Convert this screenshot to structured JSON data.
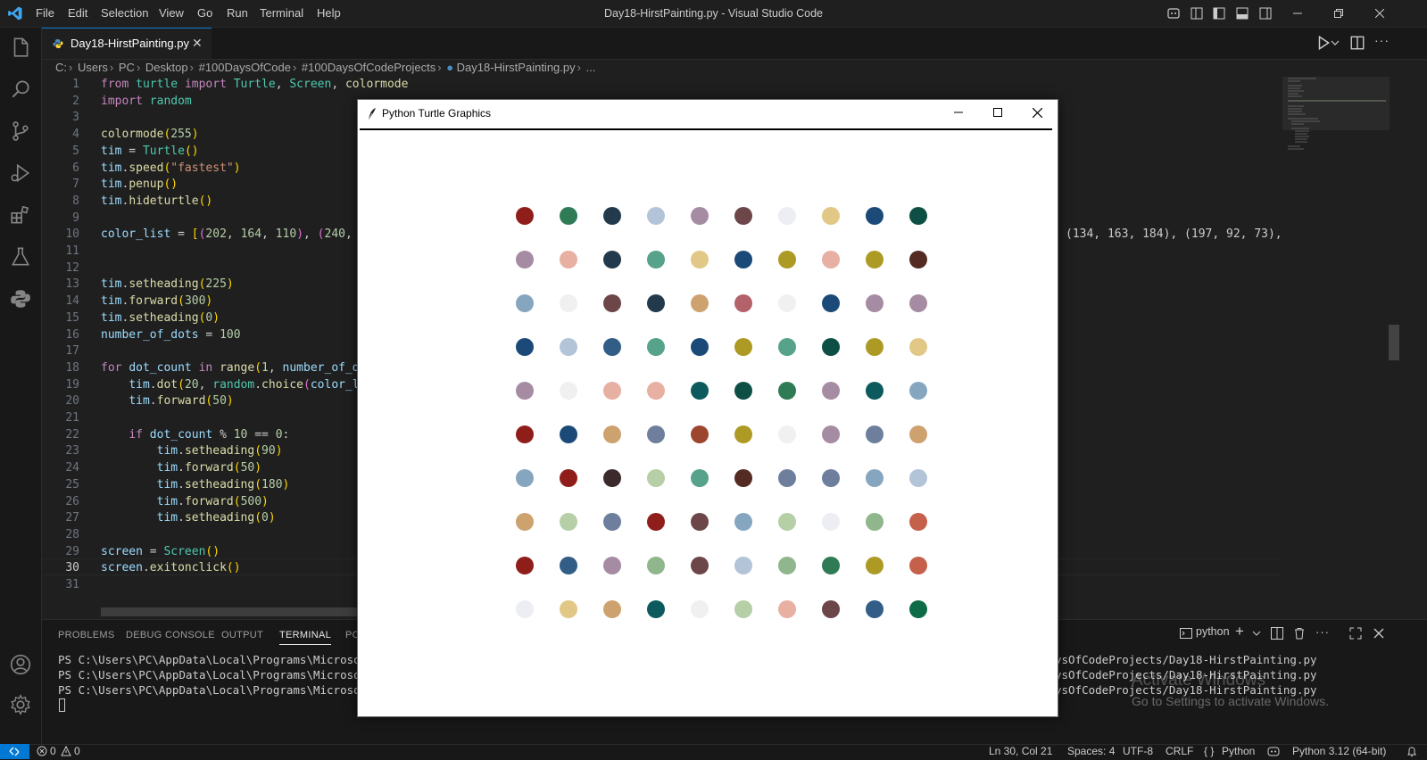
{
  "menu": [
    "File",
    "Edit",
    "Selection",
    "View",
    "Go",
    "Run",
    "Terminal",
    "Help"
  ],
  "window_title": "Day18-HirstPainting.py - Visual Studio Code",
  "tab": {
    "label": "Day18-HirstPainting.py",
    "close": "✕"
  },
  "breadcrumb": [
    "C:",
    "Users",
    "PC",
    "Desktop",
    "#100DaysOfCode",
    "#100DaysOfCodeProjects",
    "Day18-HirstPainting.py",
    "..."
  ],
  "line_numbers": [
    "1",
    "2",
    "3",
    "4",
    "5",
    "6",
    "7",
    "8",
    "9",
    "10",
    "11",
    "12",
    "13",
    "14",
    "15",
    "16",
    "17",
    "18",
    "19",
    "20",
    "21",
    "22",
    "23",
    "24",
    "25",
    "26",
    "27",
    "28",
    "29",
    "30",
    "31"
  ],
  "code_right_fragment": "(134, 163, 184), (197, 92, 73),",
  "panel_tabs": [
    "PROBLEMS",
    "DEBUG CONSOLE",
    "OUTPUT",
    "TERMINAL",
    "PC"
  ],
  "terminal": {
    "shell_label": "python",
    "line_left": "PS C:\\Users\\PC\\AppData\\Local\\Programs\\Microsoft \\",
    "line_right": "ysOfCodeProjects/Day18-HirstPainting.py"
  },
  "watermark": {
    "title": "Activate Windows",
    "subtitle": "Go to Settings to activate Windows."
  },
  "status": {
    "problems": "0",
    "warnings": "0",
    "position": "Ln 30, Col 21",
    "spaces": "Spaces: 4",
    "encoding": "UTF-8",
    "eol": "CRLF",
    "language": "Python",
    "interpreter": "Python 3.12 (64-bit)"
  },
  "turtle_window": {
    "title": "Python Turtle Graphics"
  },
  "dot_grid": [
    [
      "#8f1e1a",
      "#2f7b55",
      "#233a4c",
      "#b3c3d8",
      "#a68ca2",
      "#6c4649",
      "#eceef3",
      "#e2c886",
      "#1c4a78",
      "#0e4f45"
    ],
    [
      "#a68ca2",
      "#e8afa3",
      "#233a4c",
      "#56a28b",
      "#e2c886",
      "#1c4a78",
      "#ad9a25",
      "#e8afa3",
      "#ad9a25",
      "#532b22"
    ],
    [
      "#86a6c0",
      "#eff0ef",
      "#6c4649",
      "#233a4c",
      "#cda26f",
      "#b26268",
      "#eff0ef",
      "#1c4a78",
      "#a68ca2",
      "#a68ca2"
    ],
    [
      "#1c4a78",
      "#b3c3d8",
      "#325d86",
      "#56a28b",
      "#1c4a78",
      "#ad9a25",
      "#56a28b",
      "#0e4f45",
      "#ad9a25",
      "#e2c886"
    ],
    [
      "#a68ca2",
      "#eff0ef",
      "#e8afa3",
      "#e8afa3",
      "#0d5a5e",
      "#0e4f45",
      "#2f7b55",
      "#a68ca2",
      "#0d5a5e",
      "#86a6c0"
    ],
    [
      "#8f1e1a",
      "#1c4a78",
      "#cda26f",
      "#6d7f9c",
      "#9c4630",
      "#ad9a25",
      "#eff0ef",
      "#a68ca2",
      "#6d7f9c",
      "#cda26f"
    ],
    [
      "#86a6c0",
      "#8f1e1a",
      "#3b2a2c",
      "#b6cfa7",
      "#56a28b",
      "#532b22",
      "#6d7f9c",
      "#6d7f9c",
      "#86a6c0",
      "#b3c3d8"
    ],
    [
      "#cda26f",
      "#b6cfa7",
      "#6d7f9c",
      "#8f1e1a",
      "#6c4649",
      "#86a6c0",
      "#b6cfa7",
      "#eceef3",
      "#8fb68d",
      "#c5604a"
    ],
    [
      "#8f1e1a",
      "#325d86",
      "#a68ca2",
      "#8fb68d",
      "#6c4649",
      "#b3c3d8",
      "#8fb68d",
      "#2f7b55",
      "#ad9a25",
      "#c5604a"
    ],
    [
      "#eceef3",
      "#e2c886",
      "#cda26f",
      "#0d5a5e",
      "#eff0ef",
      "#b6cfa7",
      "#e8afa3",
      "#6c4649",
      "#325d86",
      "#0e6b47"
    ]
  ]
}
